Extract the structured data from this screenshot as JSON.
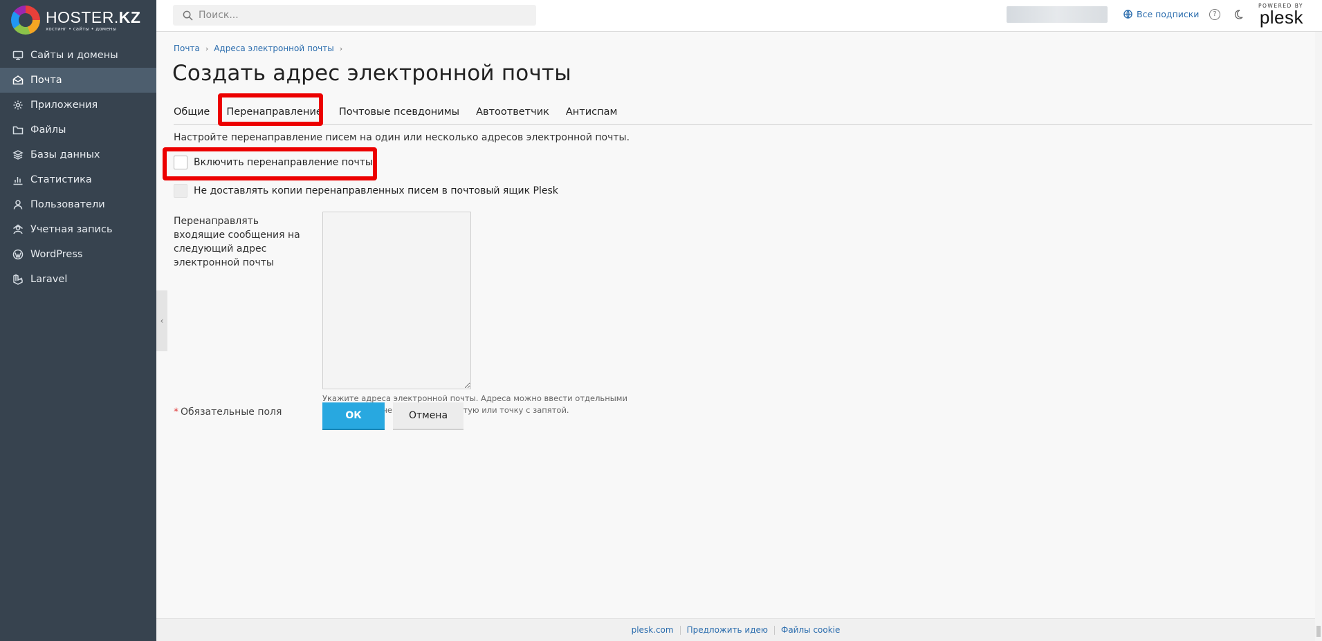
{
  "brand": {
    "name_prefix": "HOSTER.",
    "name_suffix": "KZ",
    "tagline": "хостинг • сайты • домены"
  },
  "sidebar": {
    "items": [
      {
        "label": "Сайты и домены",
        "icon": "monitor-icon"
      },
      {
        "label": "Почта",
        "icon": "mail-icon",
        "active": true
      },
      {
        "label": "Приложения",
        "icon": "gear-icon"
      },
      {
        "label": "Файлы",
        "icon": "folder-icon"
      },
      {
        "label": "Базы данных",
        "icon": "database-icon"
      },
      {
        "label": "Статистика",
        "icon": "chart-icon"
      },
      {
        "label": "Пользователи",
        "icon": "user-icon"
      },
      {
        "label": "Учетная запись",
        "icon": "account-icon"
      },
      {
        "label": "WordPress",
        "icon": "wordpress-icon"
      },
      {
        "label": "Laravel",
        "icon": "laravel-icon"
      }
    ]
  },
  "topbar": {
    "search_placeholder": "Поиск...",
    "subscriptions_label": "Все подписки",
    "help_glyph": "?",
    "plesk_powered": "POWERED BY",
    "plesk_name": "plesk"
  },
  "breadcrumb": {
    "items": [
      "Почта",
      "Адреса электронной почты"
    ],
    "separator": "›"
  },
  "page": {
    "title": "Создать адрес электронной почты"
  },
  "tabs": [
    {
      "label": "Общие"
    },
    {
      "label": "Перенаправление",
      "active": true
    },
    {
      "label": "Почтовые псевдонимы"
    },
    {
      "label": "Автоответчик"
    },
    {
      "label": "Антиспам"
    }
  ],
  "form": {
    "description": "Настройте перенаправление писем на один или несколько адресов электронной почты.",
    "enable_forwarding_label": "Включить перенаправление почты",
    "no_copies_label": "Не доставлять копии перенаправленных писем в почтовый ящик Plesk",
    "forward_label": "Перенаправлять входящие сообщения на следующий адрес электронной почты",
    "forward_value": "",
    "forward_hint": "Укажите адреса электронной почты. Адреса можно ввести отдельными строками или через пробел, запятую или точку с запятой.",
    "required_star": "*",
    "required_label": "Обязательные поля",
    "ok_label": "ОК",
    "cancel_label": "Отмена"
  },
  "collapse_glyph": "‹",
  "footer": {
    "links": [
      "plesk.com",
      "Предложить идею",
      "Файлы cookie"
    ]
  },
  "colors": {
    "sidebar_bg": "#37434f",
    "sidebar_active": "#4d5e6e",
    "link": "#2a6cad",
    "primary_button": "#28a8e0",
    "highlight": "#ec0000"
  }
}
